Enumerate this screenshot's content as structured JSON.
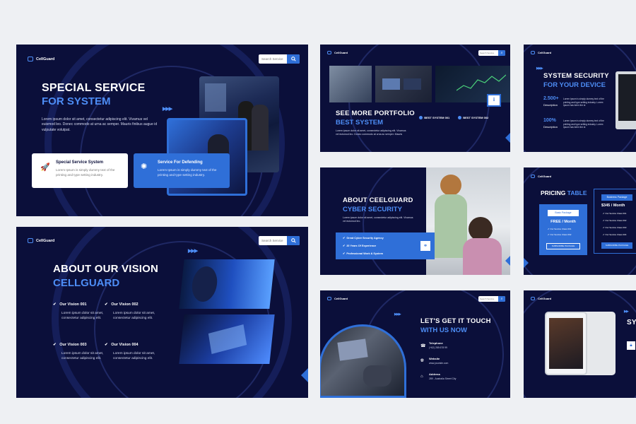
{
  "brand": "CellGuard",
  "colors": {
    "navy": "#0b0f3a",
    "accent": "#2f6fd8",
    "light_accent": "#4d8df5"
  },
  "search": {
    "placeholder": "Search Service"
  },
  "slide1": {
    "title_line1": "SPECIAL SERVICE",
    "title_line2": "FOR SYSTEM",
    "body": "Lorem ipsum dolor sit amet, consectetur adipiscing elit. Vivamus vel euismod leo. Donec commodo at urna ac semper. Mauris finibus augue id vulputate volutpat.",
    "card1_title": "Special Service System",
    "card1_text": "Lorem Ipsum is simply dummy text of the printing and type setting industry.",
    "card2_title": "Service For Defending",
    "card2_text": "Lorem Ipsum is simply dummy text of the printing and type setting industry."
  },
  "slide2": {
    "title_line1": "ABOUT OUR VISION",
    "title_line2": "CELLGUARD",
    "visions": [
      {
        "title": "Our Vision 001",
        "text": "Lorem ipsum dolor sit amet, consectetur adipiscing elit."
      },
      {
        "title": "Our Vision 002",
        "text": "Lorem ipsum dolor sit amet, consectetur adipiscing elit."
      },
      {
        "title": "Our Vision 003",
        "text": "Lorem ipsum dolor sit amet, consectetur adipiscing elit."
      },
      {
        "title": "Our Vision 004",
        "text": "Lorem ipsum dolor sit amet, consectetur adipiscing elit."
      }
    ]
  },
  "slide3": {
    "title_line1": "SEE MORE PORTFOLIO",
    "title_line2": "BEST SYSTEM",
    "body": "Lorem ipsum dolor sit amet, consectetur adipiscing elit. Vivamus vel euismod leo. Donec commodo at urna ac semper. Mauris",
    "item1": "BEST SYSTEM 001",
    "item2": "BEST SYSTEM 002"
  },
  "slide4": {
    "title_line1": "ABOUT CEELGUARD",
    "title_line2": "CYBER SECURITY",
    "body": "Lorem ipsum dolor sit amet, consectetur adipiscing elit. Vivamus vel euismod leo.",
    "points": [
      "Great Cyber Security Agency",
      "20 Years Of Experience",
      "Professional Work & System"
    ]
  },
  "slide5": {
    "title_line1": "LET'S GET IT TOUCH",
    "title_line2": "WITH US NOW",
    "phone_label": "Telephone",
    "phone_value": "(+62) 285 678 99",
    "web_label": "Website",
    "web_value": "www.yoursite.com",
    "addr_label": "Address",
    "addr_value": "289 - Australia Street City"
  },
  "slide6": {
    "title_line1": "SYSTEM SECURITY",
    "title_line2": "FOR YOUR DEVICE",
    "stat1_value": "2.500+",
    "stat1_label": "Description",
    "stat1_text": "Lorem Ipsum is simply dummy text of the printing and type setting industry. Lorem Ipsum has been the st",
    "stat2_value": "100%",
    "stat2_label": "Description",
    "stat2_text": "Lorem Ipsum is simply dummy text of the printing and type setting industry. Lorem Ipsum has been the st"
  },
  "slide7": {
    "title_word1": "PRICING",
    "title_word2": "TABLE",
    "basic_label": "Basic Package",
    "basic_price": "FREE / Month",
    "basic_features": [
      "Our Service Class 001",
      "Our Service Class 002"
    ],
    "basic_button": "SUBSCRIBE PACKAGE",
    "business_label": "Business Package",
    "business_price": "$345 / Month",
    "business_features": [
      "Our Service Class 001",
      "Our Service Class 002",
      "Our Service Class 003",
      "Our Service Class 004"
    ],
    "business_button": "SUBSCRIBE PACKAGE"
  },
  "slide8": {
    "title_partial": "SY"
  }
}
